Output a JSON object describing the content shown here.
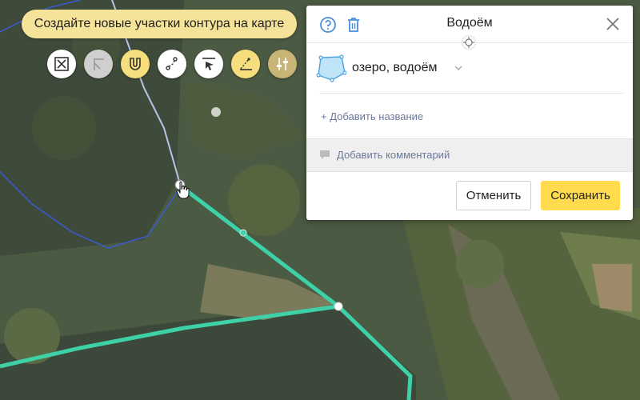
{
  "hint": {
    "text": "Создайте новые участки контура на карте"
  },
  "toolbar": {
    "tools": [
      {
        "icon": "delete-contour-icon",
        "state": "normal"
      },
      {
        "icon": "angle-tool-icon",
        "state": "disabled"
      },
      {
        "icon": "magnet-icon",
        "state": "active"
      },
      {
        "icon": "draw-path-icon",
        "state": "normal"
      },
      {
        "icon": "select-arrow-icon",
        "state": "normal"
      },
      {
        "icon": "ruler-icon",
        "state": "active"
      },
      {
        "icon": "adjust-sliders-icon",
        "state": "active-dim"
      }
    ]
  },
  "panel": {
    "title": "Водоём",
    "object_type": "озеро, водоём",
    "add_name_label": "+ Добавить название",
    "add_comment_label": "Добавить комментарий",
    "cancel_label": "Отменить",
    "save_label": "Сохранить"
  },
  "colors": {
    "accent": "#ffdb4d",
    "contour_active": "#3ed1a8",
    "contour_other": "#3a5ad6",
    "link": "#6b7a99",
    "help": "#4a90d9"
  }
}
